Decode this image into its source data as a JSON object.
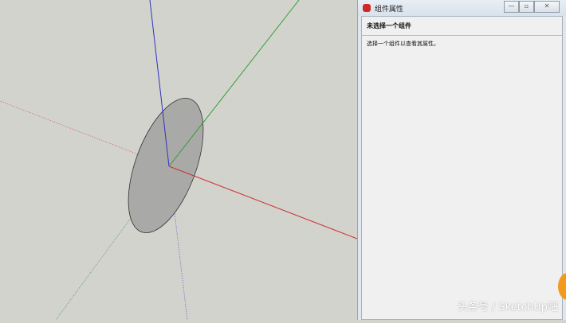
{
  "panel": {
    "title": "组件属性",
    "heading": "未选择一个组件",
    "description": "选择一个组件以查看其属性。",
    "minimize": "—",
    "maximize": "▫",
    "close": "✕"
  },
  "watermark": "头条号 / SketchUp吧",
  "colors": {
    "red_axis": "#c83030",
    "green_axis": "#30a030",
    "blue_axis": "#3030c0",
    "shape_fill": "#a9a9a7"
  }
}
